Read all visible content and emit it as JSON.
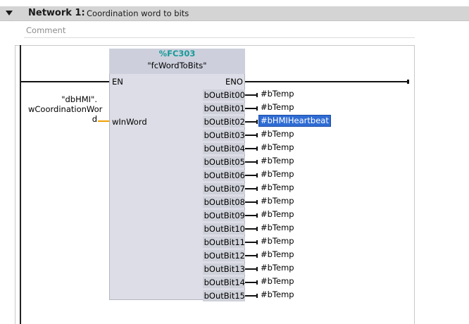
{
  "network": {
    "label": "Network 1:",
    "title": "Coordination word to bits",
    "comment_placeholder": "Comment"
  },
  "block": {
    "instance": "%FC303",
    "name": "\"fcWordToBits\"",
    "en": "EN",
    "eno": "ENO",
    "input_pin": "wInWord",
    "input_operand_line1": "\"dbHMI\".",
    "input_operand_line2": "wCoordinationWor",
    "input_operand_line3": "d"
  },
  "outputs": [
    {
      "pin": "bOutBit00",
      "operand": "#bTemp",
      "selected": false
    },
    {
      "pin": "bOutBit01",
      "operand": "#bTemp",
      "selected": false
    },
    {
      "pin": "bOutBit02",
      "operand": "#bHMIHeartbeat",
      "selected": true
    },
    {
      "pin": "bOutBit03",
      "operand": "#bTemp",
      "selected": false
    },
    {
      "pin": "bOutBit04",
      "operand": "#bTemp",
      "selected": false
    },
    {
      "pin": "bOutBit05",
      "operand": "#bTemp",
      "selected": false
    },
    {
      "pin": "bOutBit06",
      "operand": "#bTemp",
      "selected": false
    },
    {
      "pin": "bOutBit07",
      "operand": "#bTemp",
      "selected": false
    },
    {
      "pin": "bOutBit08",
      "operand": "#bTemp",
      "selected": false
    },
    {
      "pin": "bOutBit09",
      "operand": "#bTemp",
      "selected": false
    },
    {
      "pin": "bOutBit10",
      "operand": "#bTemp",
      "selected": false
    },
    {
      "pin": "bOutBit11",
      "operand": "#bTemp",
      "selected": false
    },
    {
      "pin": "bOutBit12",
      "operand": "#bTemp",
      "selected": false
    },
    {
      "pin": "bOutBit13",
      "operand": "#bTemp",
      "selected": false
    },
    {
      "pin": "bOutBit14",
      "operand": "#bTemp",
      "selected": false
    },
    {
      "pin": "bOutBit15",
      "operand": "#bTemp",
      "selected": false
    }
  ],
  "colors": {
    "instance_teal": "#179a99",
    "selection_blue": "#2f6cd4",
    "input_wire_orange": "#f0a000"
  },
  "icons": {
    "collapse": "triangle-down-icon"
  }
}
